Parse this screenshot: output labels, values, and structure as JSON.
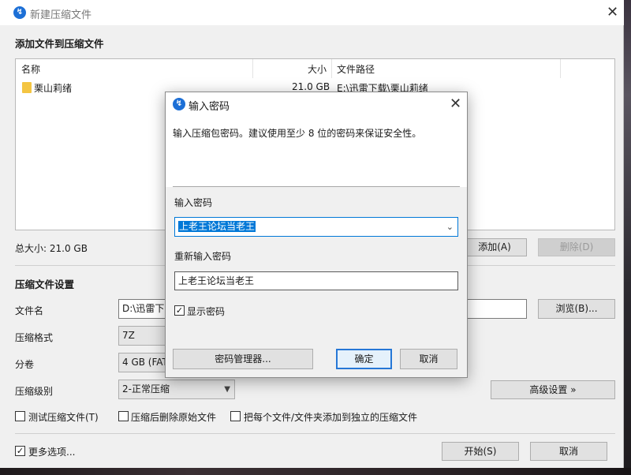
{
  "window": {
    "title": "新建压缩文件"
  },
  "files": {
    "section_title": "添加文件到压缩文件",
    "columns": {
      "name": "名称",
      "size": "大小",
      "path": "文件路径"
    },
    "rows": [
      {
        "name": "栗山莉绪",
        "size": "21.0 GB",
        "path": "E:\\迅雷下载\\栗山莉绪"
      }
    ],
    "total_size": "总大小: 21.0 GB",
    "add_button": "添加(A)",
    "delete_button": "删除(D)"
  },
  "settings": {
    "section_title": "压缩文件设置",
    "filename_label": "文件名",
    "filename_value": "D:\\迅雷下",
    "browse_button": "浏览(B)...",
    "format_label": "压缩格式",
    "format_value": "7Z",
    "split_label": "分卷",
    "split_value": "4 GB (FAT",
    "level_label": "压缩级别",
    "level_value": "2-正常压缩",
    "advanced_button": "高级设置 »",
    "test_label": "测试压缩文件(T)",
    "delete_after_label": "压缩后删除原始文件",
    "each_separate_label": "把每个文件/文件夹添加到独立的压缩文件",
    "more_options_label": "更多选项...",
    "start_button": "开始(S)",
    "cancel_button": "取消"
  },
  "dialog": {
    "title": "输入密码",
    "description": "输入压缩包密码。建议使用至少 8 位的密码来保证安全性。",
    "password_label": "输入密码",
    "password_value": "上老王论坛当老王",
    "confirm_label": "重新输入密码",
    "confirm_value": "上老王论坛当老王",
    "show_password_label": "显示密码",
    "manager_button": "密码管理器...",
    "ok_button": "确定",
    "cancel_button": "取消"
  },
  "colors": {
    "accent": "#1c6fd6",
    "selection": "#0078d7",
    "folder": "#f4c542"
  }
}
